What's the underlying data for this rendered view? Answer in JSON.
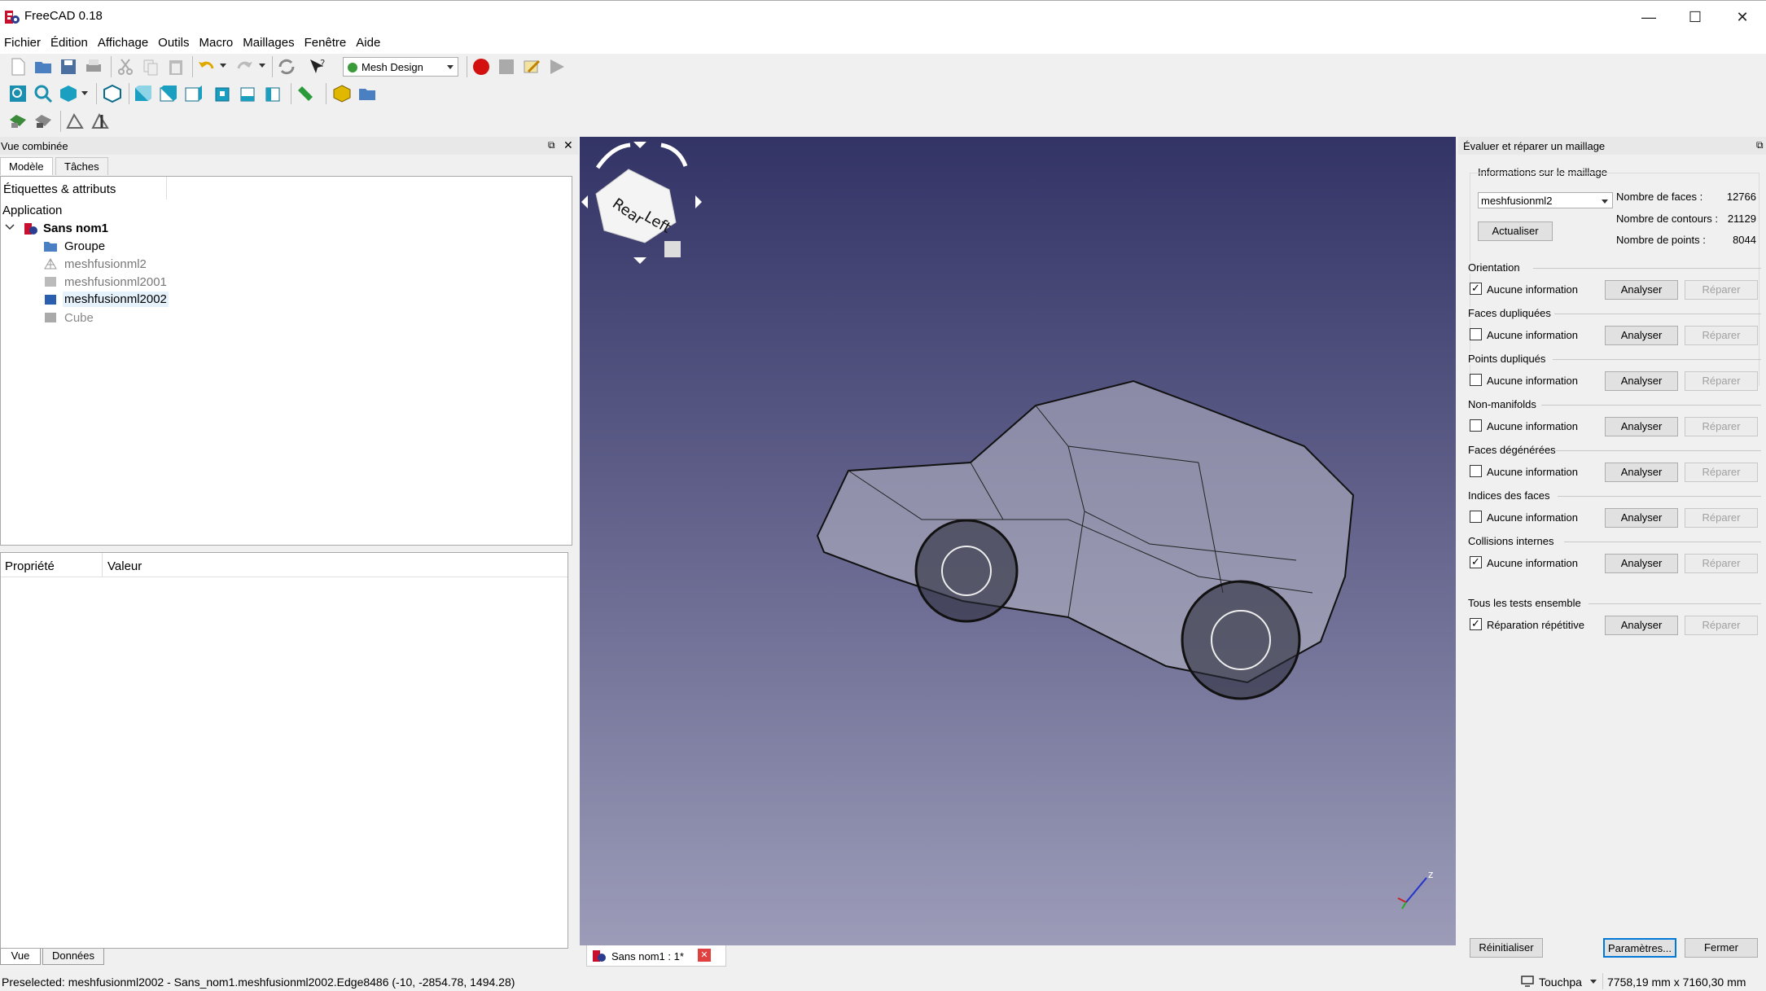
{
  "window": {
    "title": "FreeCAD 0.18"
  },
  "menu": [
    "Fichier",
    "Édition",
    "Affichage",
    "Outils",
    "Macro",
    "Maillages",
    "Fenêtre",
    "Aide"
  ],
  "toolbar": {
    "workbench": "Mesh Design"
  },
  "combo": {
    "header": "Vue combinée",
    "tabs": [
      "Modèle",
      "Tâches"
    ],
    "tree_header": "Étiquettes & attributs",
    "root": "Application",
    "document": "Sans nom1",
    "items": [
      "Groupe",
      "meshfusionml2",
      "meshfusionml2001",
      "meshfusionml2002",
      "Cube"
    ],
    "props_col1": "Propriété",
    "props_col2": "Valeur",
    "bottom_tabs": [
      "Vue",
      "Données"
    ]
  },
  "navcube": {
    "face1": "Rear",
    "face2": "Left"
  },
  "axis": {
    "z": "z"
  },
  "viewtab": {
    "label": "Sans nom1 : 1*"
  },
  "panel": {
    "title": "Évaluer et réparer un maillage",
    "info_group": "Informations sur le maillage",
    "mesh_select": "meshfusionml2",
    "refresh": "Actualiser",
    "faces_label": "Nombre de faces :",
    "faces_value": "12766",
    "contours_label": "Nombre de contours :",
    "contours_value": "21129",
    "points_label": "Nombre de points :",
    "points_value": "8044",
    "checks": [
      {
        "group": "Orientation",
        "text": "Aucune information",
        "checked": true
      },
      {
        "group": "Faces dupliquées",
        "text": "Aucune information",
        "checked": false
      },
      {
        "group": "Points dupliqués",
        "text": "Aucune information",
        "checked": false
      },
      {
        "group": "Non-manifolds",
        "text": "Aucune information",
        "checked": false
      },
      {
        "group": "Faces dégénérées",
        "text": "Aucune information",
        "checked": false
      },
      {
        "group": "Indices des faces",
        "text": "Aucune information",
        "checked": false
      },
      {
        "group": "Collisions internes",
        "text": "Aucune information",
        "checked": true
      }
    ],
    "all_tests": {
      "group": "Tous les tests ensemble",
      "text": "Réparation répétitive",
      "checked": true
    },
    "analyze": "Analyser",
    "repair": "Réparer",
    "reset": "Réinitialiser",
    "settings": "Paramètres...",
    "close": "Fermer"
  },
  "status": {
    "message": "Preselected: meshfusionml2002 - Sans_nom1.meshfusionml2002.Edge8486 (-10, -2854.78, 1494.28)",
    "nav": "Touchpa",
    "dims": "7758,19 mm x 7160,30 mm"
  }
}
